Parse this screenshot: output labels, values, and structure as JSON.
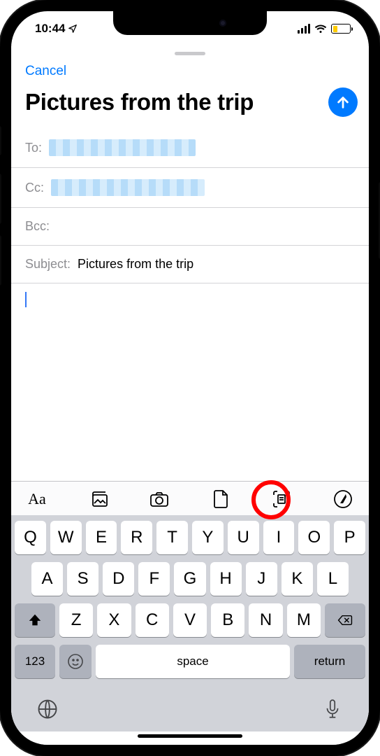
{
  "statusBar": {
    "time": "10:44"
  },
  "sheet": {
    "cancel": "Cancel",
    "title": "Pictures from the trip"
  },
  "fields": {
    "toLabel": "To:",
    "ccLabel": "Cc:",
    "bccLabel": "Bcc:",
    "subjectLabel": "Subject:",
    "subjectValue": "Pictures from the trip"
  },
  "toolbar": {
    "aa": "Aa"
  },
  "keyboard": {
    "row1": [
      "Q",
      "W",
      "E",
      "R",
      "T",
      "Y",
      "U",
      "I",
      "O",
      "P"
    ],
    "row2": [
      "A",
      "S",
      "D",
      "F",
      "G",
      "H",
      "J",
      "K",
      "L"
    ],
    "row3": [
      "Z",
      "X",
      "C",
      "V",
      "B",
      "N",
      "M"
    ],
    "numKey": "123",
    "space": "space",
    "return": "return"
  }
}
